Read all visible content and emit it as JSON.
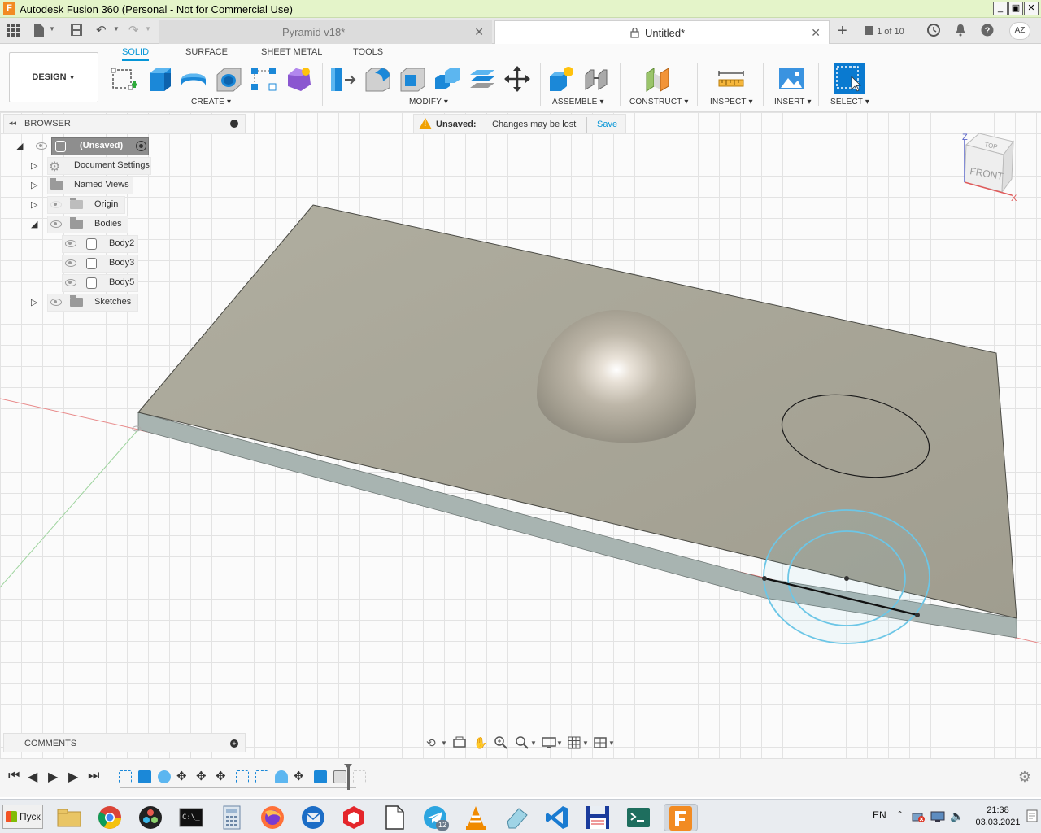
{
  "window": {
    "title": "Autodesk Fusion 360 (Personal - Not for Commercial Use)",
    "app_icon": "F",
    "controls": [
      "_",
      "▣",
      "✕"
    ]
  },
  "tabs": {
    "inactive": {
      "label": "Pyramid v18*"
    },
    "active": {
      "label": "Untitled*"
    },
    "job_status": "1 of 10",
    "avatar": "AZ"
  },
  "toolbar": {
    "workspace": "DESIGN",
    "workspace_tabs": [
      "SOLID",
      "SURFACE",
      "SHEET METAL",
      "TOOLS"
    ],
    "active_tab": "SOLID",
    "groups": {
      "create": "CREATE",
      "modify": "MODIFY",
      "assemble": "ASSEMBLE",
      "construct": "CONSTRUCT",
      "inspect": "INSPECT",
      "insert": "INSERT",
      "select": "SELECT"
    }
  },
  "browser": {
    "title": "BROWSER",
    "root": "(Unsaved)",
    "items": [
      {
        "label": "Document Settings"
      },
      {
        "label": "Named Views"
      },
      {
        "label": "Origin"
      },
      {
        "label": "Bodies"
      },
      {
        "label": "Body2"
      },
      {
        "label": "Body3"
      },
      {
        "label": "Body5"
      },
      {
        "label": "Sketches"
      }
    ]
  },
  "banner": {
    "label": "Unsaved:",
    "message": "Changes may be lost",
    "action": "Save"
  },
  "viewcube": {
    "top": "TOP",
    "front": "FRONT",
    "z": "Z",
    "x": "X"
  },
  "comments": {
    "title": "COMMENTS"
  },
  "taskbar": {
    "start": "Пуск",
    "badge": "12",
    "lang": "EN",
    "time": "21:38",
    "date": "03.03.2021"
  },
  "colors": {
    "accent": "#0696d7",
    "title_bar": "#e4f4c9",
    "plate_top": "#a8a698",
    "plate_side": "#a9b5b2",
    "warning": "#f0a000"
  }
}
